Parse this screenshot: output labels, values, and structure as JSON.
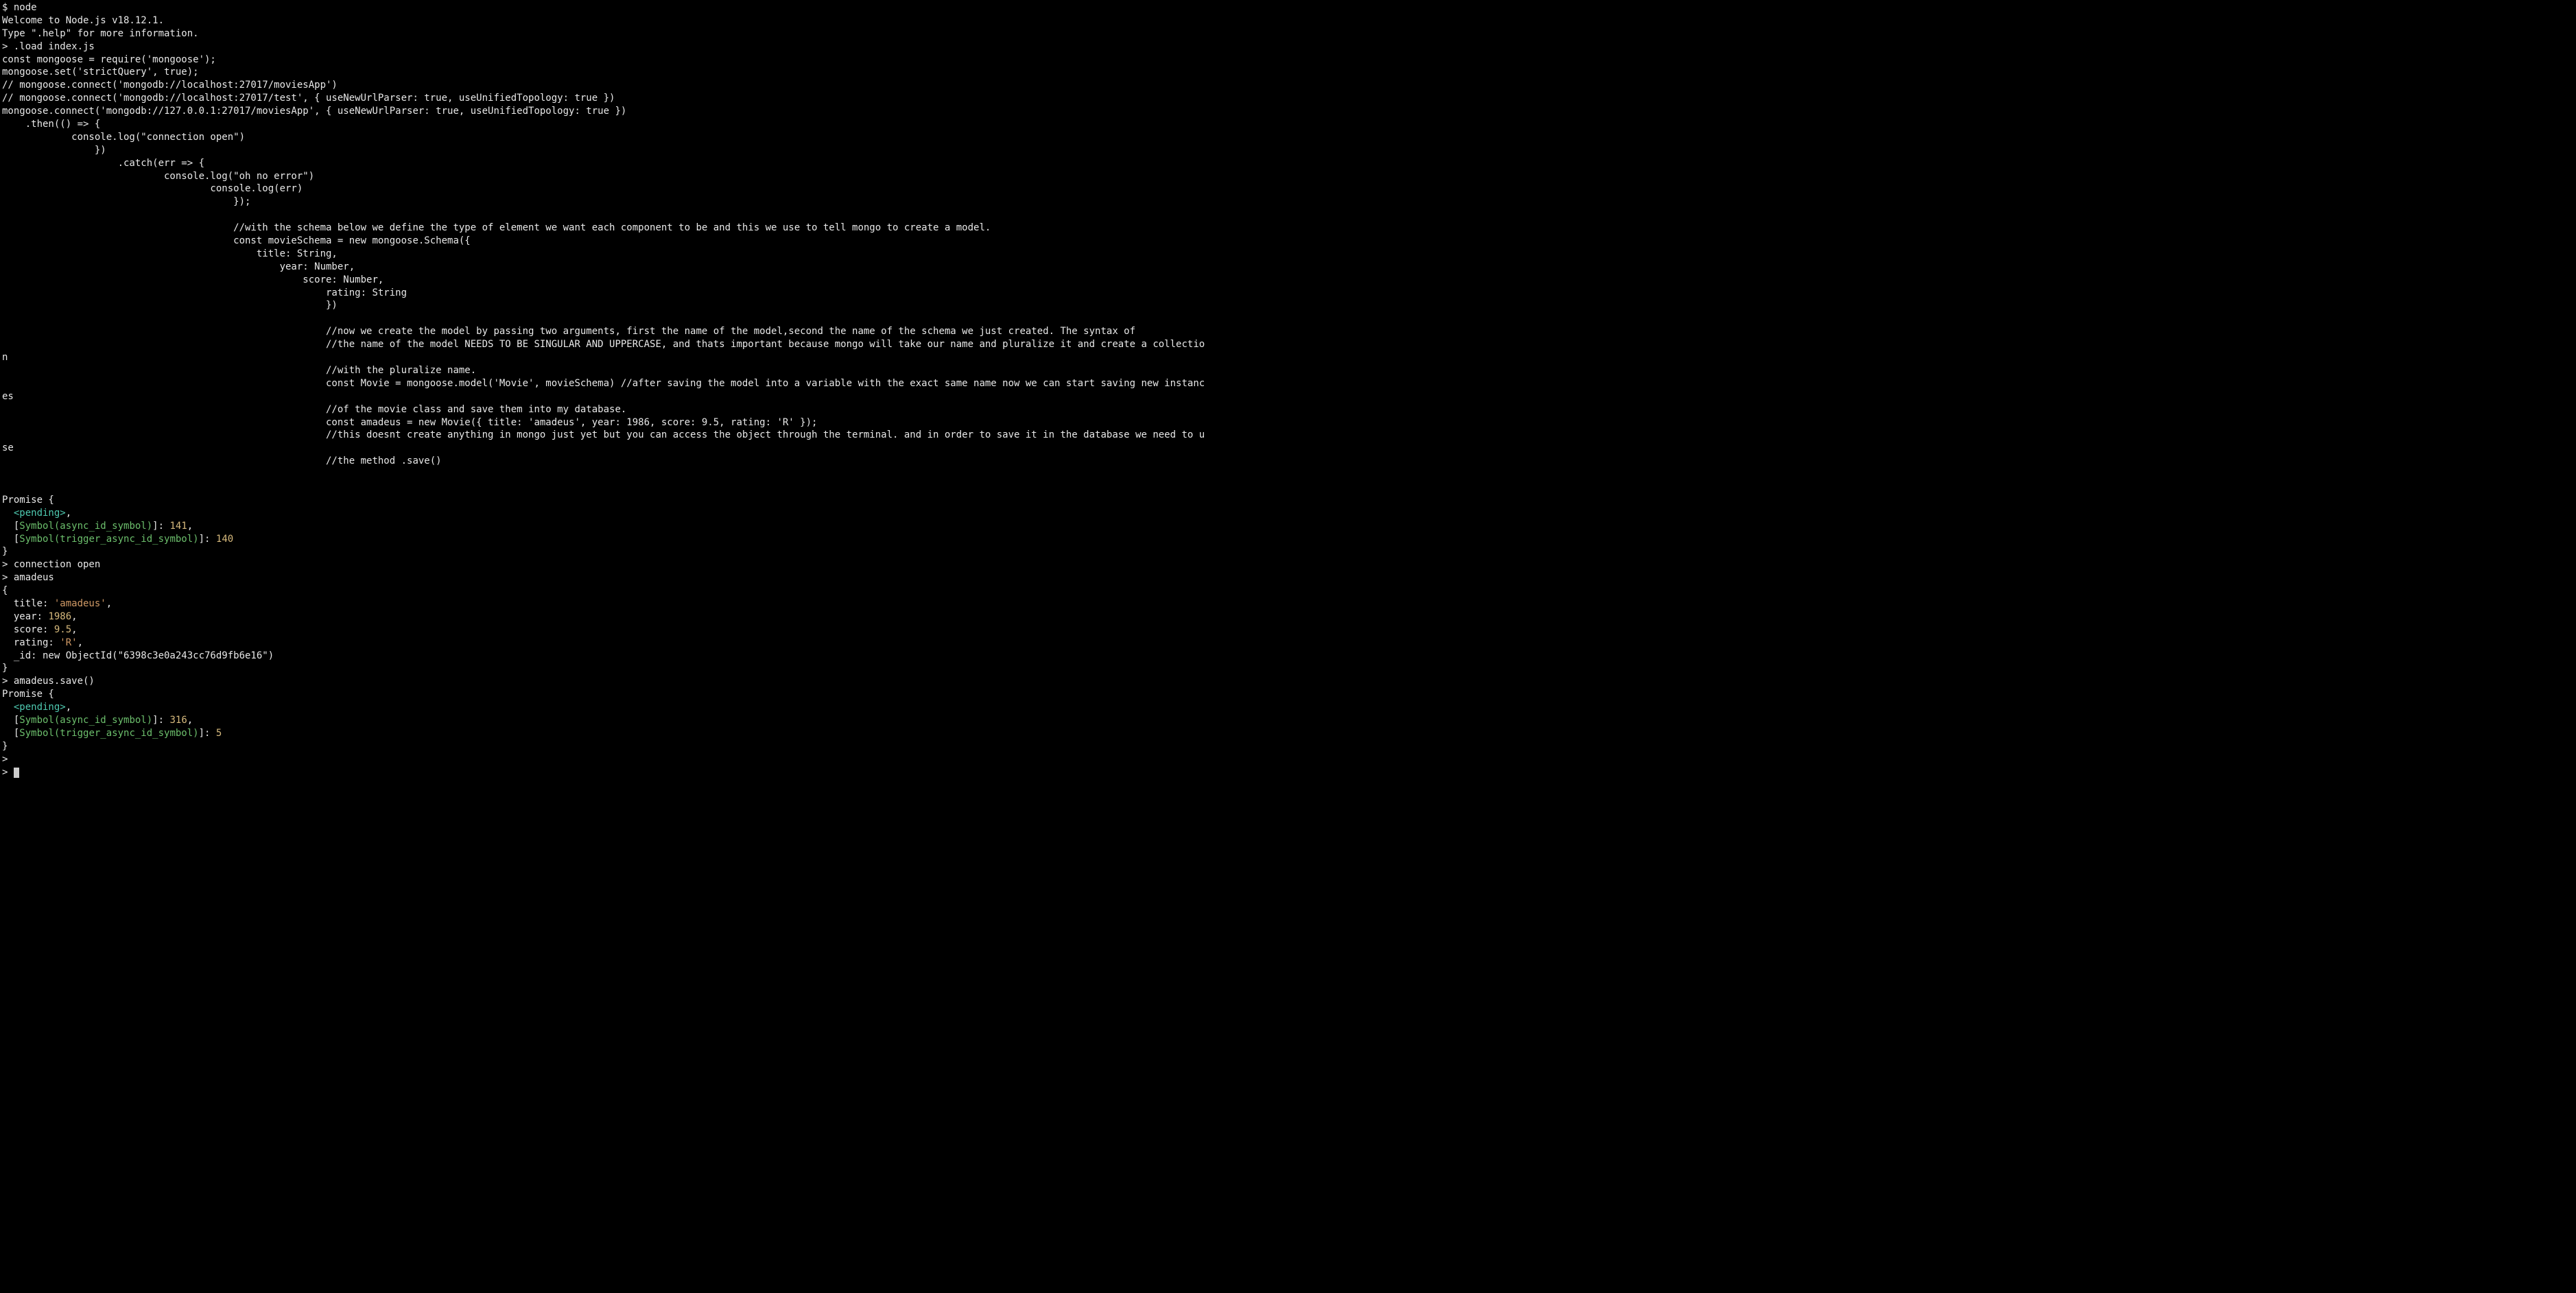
{
  "lines": {
    "l0": "$ node",
    "l1": "Welcome to Node.js v18.12.1.",
    "l2": "Type \".help\" for more information.",
    "l3": "> .load index.js",
    "l4": "const mongoose = require('mongoose');",
    "l5": "mongoose.set('strictQuery', true);",
    "l6": "// mongoose.connect('mongodb://localhost:27017/moviesApp')",
    "l7": "// mongoose.connect('mongodb://localhost:27017/test', { useNewUrlParser: true, useUnifiedTopology: true })",
    "l8": "mongoose.connect('mongodb://127.0.0.1:27017/moviesApp', { useNewUrlParser: true, useUnifiedTopology: true })",
    "l9": "    .then(() => {",
    "l10": "            console.log(\"connection open\")",
    "l11": "                })",
    "l12": "                    .catch(err => {",
    "l13": "                            console.log(\"oh no error\")",
    "l14": "                                    console.log(err)",
    "l15": "                                        });",
    "l16": "",
    "l17": "                                        //with the schema below we define the type of element we want each component to be and this we use to tell mongo to create a model.",
    "l18": "                                        const movieSchema = new mongoose.Schema({",
    "l19": "                                            title: String,",
    "l20": "                                                year: Number,",
    "l21": "                                                    score: Number,",
    "l22": "                                                        rating: String",
    "l23": "                                                        })",
    "l24": "",
    "l25": "                                                        //now we create the model by passing two arguments, first the name of the model,second the name of the schema we just created. The syntax of",
    "l26": "                                                        //the name of the model NEEDS TO BE SINGULAR AND UPPERCASE, and thats important because mongo will take our name and pluralize it and create a collectio",
    "l27": "n",
    "l28": "                                                        //with the pluralize name.",
    "l29": "                                                        const Movie = mongoose.model('Movie', movieSchema) //after saving the model into a variable with the exact same name now we can start saving new instanc",
    "l30": "es",
    "l31": "                                                        //of the movie class and save them into my database.",
    "l32": "                                                        const amadeus = new Movie({ title: 'amadeus', year: 1986, score: 9.5, rating: 'R' });",
    "l33": "                                                        //this doesnt create anything in mongo just yet but you can access the object through the terminal. and in order to save it in the database we need to u",
    "l34": "se",
    "l35": "                                                        //the method .save()",
    "l36": "",
    "l37": "",
    "l38": "Promise {",
    "p1_pending": "  <pending>",
    "p1_pending_end": ",",
    "p1_sym1_a": "  [",
    "p1_sym1_b": "Symbol(async_id_symbol)",
    "p1_sym1_c": "]: ",
    "p1_sym1_d": "141",
    "p1_sym1_e": ",",
    "p1_sym2_a": "  [",
    "p1_sym2_b": "Symbol(trigger_async_id_symbol)",
    "p1_sym2_c": "]: ",
    "p1_sym2_d": "140",
    "l43": "}",
    "l44": "> connection open",
    "l45": "> amadeus",
    "l46": "{",
    "obj_title_k": "  title: ",
    "obj_title_v": "'amadeus'",
    "comma": ",",
    "obj_year_k": "  year: ",
    "obj_year_v": "1986",
    "obj_score_k": "  score: ",
    "obj_score_v": "9.5",
    "obj_rating_k": "  rating: ",
    "obj_rating_v": "'R'",
    "obj_id": "  _id: new ObjectId(\"6398c3e0a243cc76d9fb6e16\")",
    "l52": "}",
    "l53": "> amadeus.save()",
    "l54": "Promise {",
    "p2_pending": "  <pending>",
    "p2_pending_end": ",",
    "p2_sym1_a": "  [",
    "p2_sym1_b": "Symbol(async_id_symbol)",
    "p2_sym1_c": "]: ",
    "p2_sym1_d": "316",
    "p2_sym1_e": ",",
    "p2_sym2_a": "  [",
    "p2_sym2_b": "Symbol(trigger_async_id_symbol)",
    "p2_sym2_c": "]: ",
    "p2_sym2_d": "5",
    "l58": "}",
    "l59": "> ",
    "l60": "> "
  }
}
